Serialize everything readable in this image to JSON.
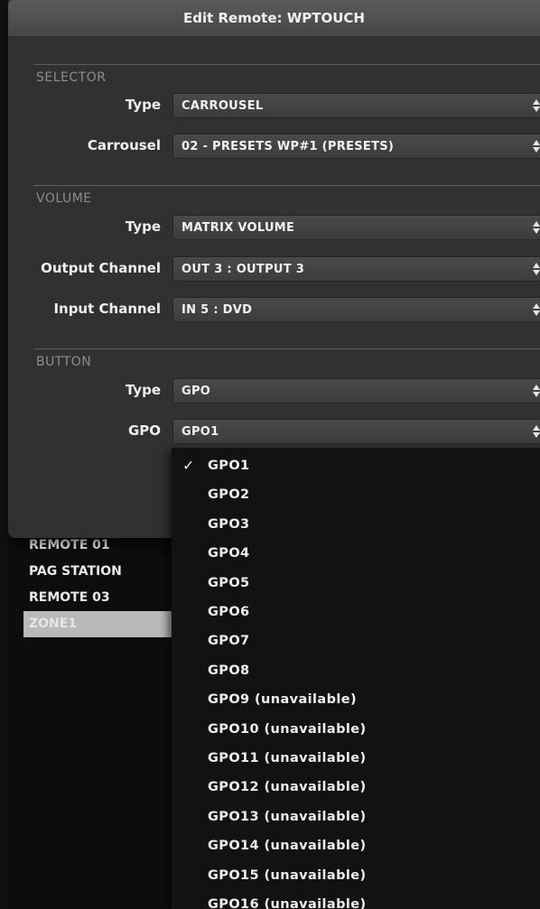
{
  "dialog": {
    "title": "Edit Remote: WPTOUCH"
  },
  "background_list": {
    "items": [
      {
        "label": "REMOTE 01"
      },
      {
        "label": "PAG STATION"
      },
      {
        "label": "REMOTE 03"
      },
      {
        "label": "ZONE1",
        "selected": true
      }
    ]
  },
  "selector": {
    "heading": "SELECTOR",
    "type_label": "Type",
    "type_value": "CARROUSEL",
    "carrousel_label": "Carrousel",
    "carrousel_value": "02 - PRESETS WP#1 (PRESETS)"
  },
  "volume": {
    "heading": "VOLUME",
    "type_label": "Type",
    "type_value": "MATRIX VOLUME",
    "output_label": "Output Channel",
    "output_value": "OUT 3 : OUTPUT 3",
    "input_label": "Input Channel",
    "input_value": "IN 5 : DVD"
  },
  "button": {
    "heading": "BUTTON",
    "type_label": "Type",
    "type_value": "GPO",
    "gpo_label": "GPO",
    "gpo_value": "GPO1"
  },
  "gpo_menu": {
    "check_glyph": "✓",
    "items": [
      "GPO1",
      "GPO2",
      "GPO3",
      "GPO4",
      "GPO5",
      "GPO6",
      "GPO7",
      "GPO8",
      "GPO9 (unavailable)",
      "GPO10 (unavailable)",
      "GPO11 (unavailable)",
      "GPO12 (unavailable)",
      "GPO13 (unavailable)",
      "GPO14 (unavailable)",
      "GPO15 (unavailable)",
      "GPO16 (unavailable)"
    ],
    "selected_index": 0
  }
}
